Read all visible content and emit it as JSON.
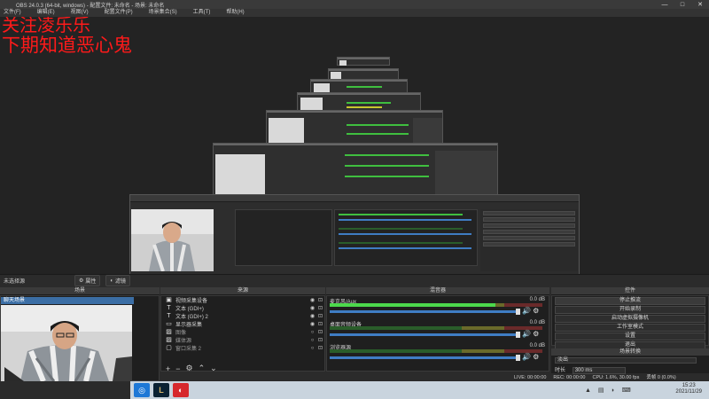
{
  "window": {
    "title": "OBS 24.0.3 (64-bit, windows) - 配置文件: 未命名 - 场景: 未命名",
    "controls": [
      "—",
      "□",
      "✕"
    ]
  },
  "menu": [
    "文件(F)",
    "编辑(E)",
    "视图(V)",
    "配置文件(P)",
    "场景集合(S)",
    "工具(T)",
    "帮助(H)"
  ],
  "overlay": {
    "line1": "关注凌乐乐",
    "line2": "下期知道恶心鬼"
  },
  "scene_toolbar": {
    "current_scene": "未选择源",
    "properties": "属性",
    "filters": "滤镜"
  },
  "docks": {
    "scenes": "场景",
    "sources": "来源",
    "mixer": "混音器",
    "controls": "控件",
    "transitions": "场景转换"
  },
  "scenes": [
    "聊天场景"
  ],
  "sources": [
    {
      "icon": "camera-icon",
      "label": "视频采集设备",
      "hidden": false
    },
    {
      "icon": "text-icon",
      "label": "文本 (GDI+)",
      "hidden": false
    },
    {
      "icon": "text-icon",
      "label": "文本 (GDI+) 2",
      "hidden": false
    },
    {
      "icon": "monitor-icon",
      "label": "显示器采集",
      "hidden": false
    },
    {
      "icon": "image-icon",
      "label": "图像",
      "hidden": true
    },
    {
      "icon": "image-icon",
      "label": "媒体源",
      "hidden": true
    },
    {
      "icon": "window-icon",
      "label": "窗口采集 2",
      "hidden": true
    }
  ],
  "mixer": [
    {
      "name": "麦克风/Aux",
      "db": "0.0 dB",
      "level": 0.78
    },
    {
      "name": "桌面音频设备",
      "db": "0.0 dB",
      "level": 0.0
    },
    {
      "name": "浏览器源",
      "db": "0.0 dB",
      "level": 0.0
    }
  ],
  "controls": [
    {
      "label": "停止推流",
      "active": true
    },
    {
      "label": "开始录制",
      "active": false
    },
    {
      "label": "启动虚拟摄像机",
      "active": false
    },
    {
      "label": "工作室模式",
      "active": false
    },
    {
      "label": "设置",
      "active": false
    },
    {
      "label": "退出",
      "active": false
    }
  ],
  "transitions": {
    "selected": "淡出",
    "duration_label": "时长",
    "duration_value": "300 ms"
  },
  "status": {
    "live": "LIVE: 00:00:00",
    "rec": "REC: 00:00:00",
    "cpu": "CPU: 1.6%, 30.00 fps",
    "dropped": "丢帧 0 (0.0%)"
  },
  "clock": {
    "time": "15:23",
    "date": "2021/11/29"
  },
  "colors": {
    "scene_highlight": "#3b6ea5",
    "overlay_text": "#ff1a1a",
    "meter_green": "#4cd94c",
    "slider_blue": "#3f7dc4"
  }
}
